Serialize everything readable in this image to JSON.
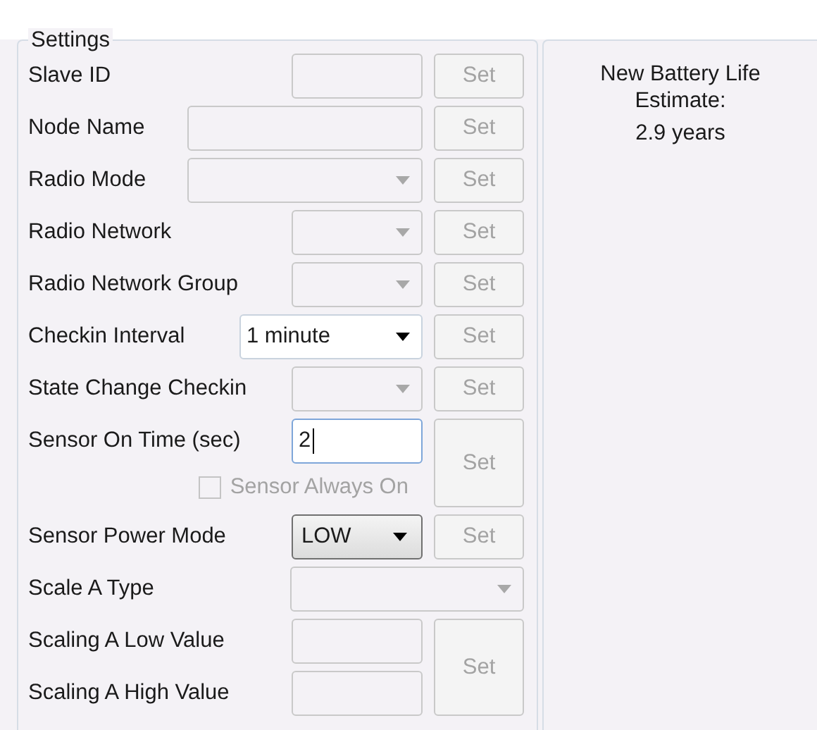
{
  "settings": {
    "title": "Settings",
    "rows": [
      {
        "label": "Slave ID",
        "kind": "text",
        "disabled": true,
        "set": {
          "label": "Set",
          "disabled": true
        }
      },
      {
        "label": "Node Name",
        "kind": "text",
        "disabled": true,
        "set": {
          "label": "Set",
          "disabled": true
        }
      },
      {
        "label": "Radio Mode",
        "kind": "combo",
        "disabled": true,
        "set": {
          "label": "Set",
          "disabled": true
        }
      },
      {
        "label": "Radio Network",
        "kind": "combo",
        "disabled": true,
        "set": {
          "label": "Set",
          "disabled": true
        }
      },
      {
        "label": "Radio Network Group",
        "kind": "combo",
        "disabled": true,
        "set": {
          "label": "Set",
          "disabled": true
        }
      },
      {
        "label": "Checkin Interval",
        "kind": "combo",
        "value": "1 minute",
        "disabled": false,
        "set": {
          "label": "Set",
          "disabled": true
        }
      },
      {
        "label": "State Change Checkin",
        "kind": "combo",
        "disabled": true,
        "set": {
          "label": "Set",
          "disabled": true
        }
      }
    ],
    "sensor_on_time": {
      "label": "Sensor On Time (sec)",
      "value": "2",
      "disabled": false,
      "set": {
        "label": "Set",
        "disabled": true
      },
      "checkbox": {
        "label": "Sensor Always On",
        "checked": false,
        "disabled": true
      }
    },
    "sensor_power_mode": {
      "label": "Sensor Power Mode",
      "value": "LOW",
      "disabled": false,
      "set": {
        "label": "Set",
        "disabled": true
      }
    },
    "scale_a_type": {
      "label": "Scale A Type",
      "disabled": true
    },
    "scaling": {
      "rows": [
        {
          "label": "Scaling A Low Value",
          "disabled": true
        },
        {
          "label": "Scaling A High Value",
          "disabled": true
        }
      ],
      "set": {
        "label": "Set",
        "disabled": true
      }
    }
  },
  "battery": {
    "title": "New Battery Life Estimate:",
    "value": "2.9 years"
  }
}
